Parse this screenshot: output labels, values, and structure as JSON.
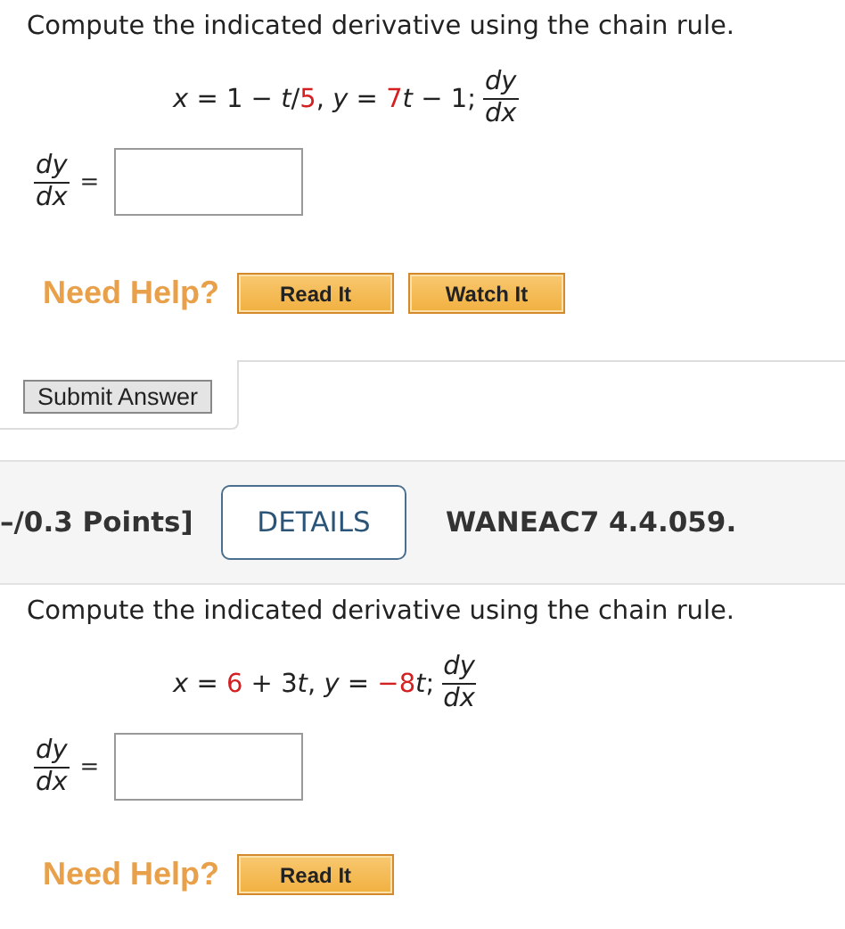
{
  "problem_1": {
    "instruction": "Compute the indicated derivative using the chain rule.",
    "equation": [
      {
        "text": "*x* = 1 − *t*/",
        "highlighted": false
      },
      {
        "text": "5",
        "highlighted": true
      },
      {
        "text": ", *y* = ",
        "highlighted": false
      },
      {
        "text": "7",
        "highlighted": true
      },
      {
        "text": "*t* − 1;",
        "highlighted": false
      }
    ],
    "equation_fraction": {
      "numerator": "dy",
      "denominator": "dx"
    },
    "answer_label": {
      "numerator": "dy",
      "denominator": "dx"
    },
    "answer_sign": "=",
    "help_label": "Need Help?",
    "help_buttons": [
      "Read It",
      "Watch It"
    ]
  },
  "submit_button": "Submit Answer",
  "question_header": {
    "points": "–/0.3 Points]",
    "details_button": "DETAILS",
    "question_id": "WANEAC7 4.4.059."
  },
  "problem_2": {
    "instruction": "Compute the indicated derivative using the chain rule.",
    "equation": [
      {
        "text": "*x* = ",
        "highlighted": false
      },
      {
        "text": "6",
        "highlighted": true
      },
      {
        "text": " + 3",
        "highlighted": false
      },
      {
        "text": "*t*, *y* = ",
        "highlighted": false
      },
      {
        "text": "−8",
        "highlighted": true
      },
      {
        "text": "*t*;",
        "highlighted": false
      }
    ],
    "equation_fraction": {
      "numerator": "dy",
      "denominator": "dx"
    },
    "answer_label": {
      "numerator": "dy",
      "denominator": "dx"
    },
    "answer_sign": "=",
    "help_label": "Need Help?",
    "help_buttons": [
      "Read It"
    ]
  }
}
